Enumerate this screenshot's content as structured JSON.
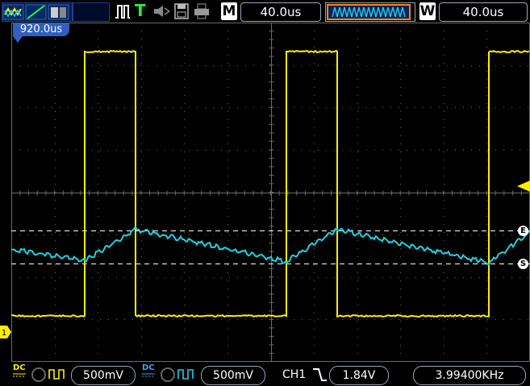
{
  "top_bar": {
    "mode_icons": [
      "ch-waveform-icon",
      "cursor-slope-icon",
      "persistence-icon"
    ],
    "run_state_icon": "pulse-run-icon",
    "trigger_label": "T",
    "horizontal_main_badge": "M",
    "horizontal_main_value": "40.0us",
    "window_badge": "W",
    "window_value": "40.0us"
  },
  "trigger_delay": "920.0us",
  "markers": {
    "e_label": "E",
    "s_label": "S",
    "ch_arrow": "1"
  },
  "bottom_bar": {
    "ch1_coupling": "DC",
    "ch1_scale": "500mV",
    "ch2_coupling": "DC",
    "ch2_scale": "500mV",
    "trigger_source": "CH1",
    "trigger_level": "1.84V",
    "frequency": "3.99400KHz"
  },
  "colors": {
    "ch1": "#ffee00",
    "ch2": "#22d0e0",
    "grid": "#6b6b6b",
    "accent_blue": "#3060c0",
    "trigger_orange": "#ff8a00"
  },
  "waveform": {
    "ch1_type": "square",
    "ch2_type": "triangle",
    "frequency_khz": 3.994
  }
}
